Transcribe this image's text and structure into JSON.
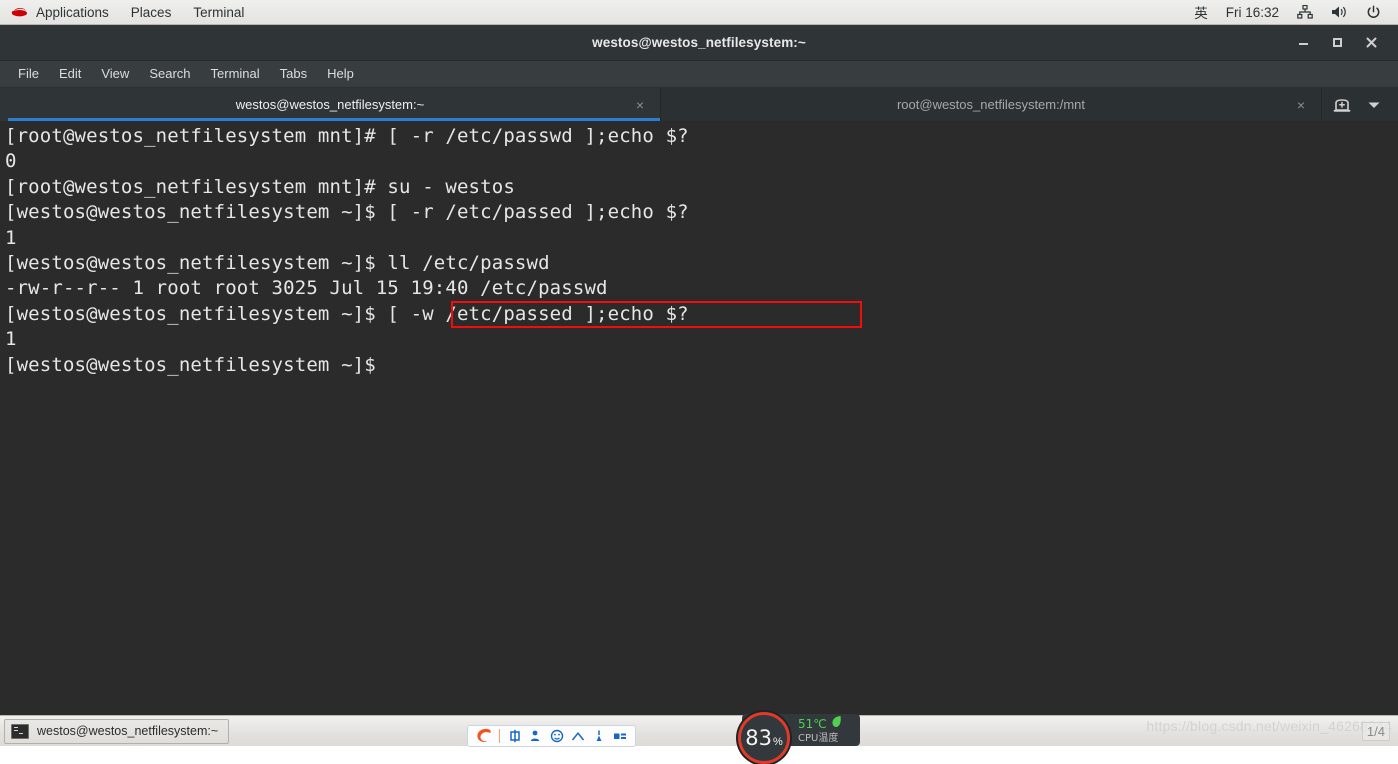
{
  "top_panel": {
    "logo_icon": "redhat-logo-icon",
    "menus": [
      "Applications",
      "Places",
      "Terminal"
    ],
    "lang_indicator": "英",
    "clock": "Fri 16:32",
    "tray_icons": [
      "network-icon",
      "volume-icon",
      "power-icon"
    ]
  },
  "window": {
    "title": "westos@westos_netfilesystem:~",
    "controls": {
      "minimize": "minimize-icon",
      "maximize": "maximize-icon",
      "close": "close-icon"
    },
    "menubar": [
      "File",
      "Edit",
      "View",
      "Search",
      "Terminal",
      "Tabs",
      "Help"
    ],
    "tabs": [
      {
        "label": "westos@westos_netfilesystem:~",
        "active": true,
        "close": "×"
      },
      {
        "label": "root@westos_netfilesystem:/mnt",
        "active": false,
        "close": "×"
      }
    ],
    "tab_actions": {
      "new_tab": "new-tab-icon",
      "tab_list": "chevron-down-icon"
    }
  },
  "terminal": {
    "background_color": "#2b2b2b",
    "foreground_color": "#e6e6e6",
    "content": "[root@westos_netfilesystem mnt]# [ -r /etc/passwd ];echo $?\n0\n[root@westos_netfilesystem mnt]# su - westos\n[westos@westos_netfilesystem ~]$ [ -r /etc/passed ];echo $?\n1\n[westos@westos_netfilesystem ~]$ ll /etc/passwd\n-rw-r--r-- 1 root root 3025 Jul 15 19:40 /etc/passwd\n[westos@westos_netfilesystem ~]$ [ -w /etc/passed ];echo $?\n1\n[westos@westos_netfilesystem ~]$ ",
    "annotation": {
      "color": "#f40b0b",
      "highlighted_text": "[ -w /etc/passed ];echo $?"
    }
  },
  "taskbar": {
    "task_button": {
      "icon": "terminal-icon",
      "label": "westos@westos_netfilesystem:~"
    },
    "ime": {
      "logo_icon": "sogou-logo-icon",
      "icons": [
        "chinese-mode-icon",
        "person-icon",
        "smiley-icon",
        "cloud-icon",
        "pen-icon",
        "keyboard-icon"
      ]
    },
    "cpu_widget": {
      "usage_percent": "83",
      "percent_sign": "%",
      "temperature": "51℃",
      "temp_label": "CPU温度",
      "leaf_icon": "leaf-icon",
      "gauge_color": "#e23a28",
      "temp_color": "#4fd14f"
    },
    "watermark": "https://blog.csdn.net/weixin_46268244",
    "page_indicator": "1/4"
  }
}
